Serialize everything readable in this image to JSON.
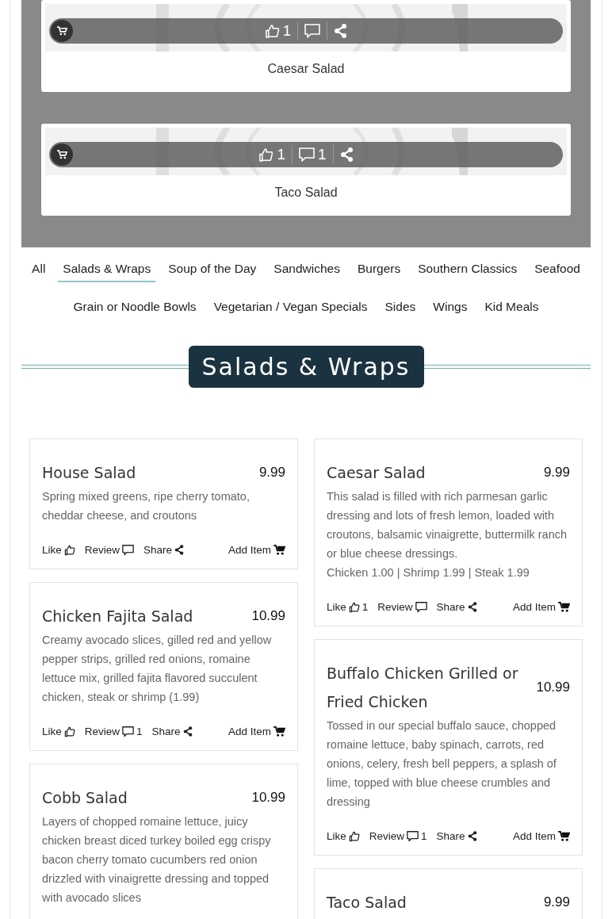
{
  "featured": [
    {
      "name": "Caesar Salad",
      "likes": "1"
    },
    {
      "name": "Taco Salad",
      "likes": "1",
      "reviews": "1"
    }
  ],
  "categories": [
    {
      "label": "All",
      "selected": false
    },
    {
      "label": "Salads & Wraps",
      "selected": true
    },
    {
      "label": "Soup of the Day",
      "selected": false
    },
    {
      "label": "Sandwiches",
      "selected": false
    },
    {
      "label": "Burgers",
      "selected": false
    },
    {
      "label": "Southern Classics",
      "selected": false
    },
    {
      "label": "Seafood",
      "selected": false
    },
    {
      "label": "Grain or Noodle Bowls",
      "selected": false
    },
    {
      "label": "Vegetarian / Vegan Specials",
      "selected": false
    },
    {
      "label": "Sides",
      "selected": false
    },
    {
      "label": "Wings",
      "selected": false
    },
    {
      "label": "Kid Meals",
      "selected": false
    }
  ],
  "section_title": "Salads & Wraps",
  "columns": [
    [
      {
        "name": "House Salad",
        "price": "9.99",
        "description": "Spring mixed greens, ripe cherry tomato, cheddar cheese, and croutons",
        "like": "Like",
        "review": "Review",
        "share": "Share",
        "add": "Add Item"
      },
      {
        "name": "Chicken Fajita Salad",
        "price": "10.99",
        "description": "Creamy avocado slices, gilled red and yellow pepper strips, grilled red onions, romaine lettuce mix, grilled fajita flavored succulent chicken, steak or shrimp (1.99)",
        "like": "Like",
        "review": "Review",
        "review_count": "1",
        "share": "Share",
        "add": "Add Item"
      },
      {
        "name": "Cobb Salad",
        "price": "10.99",
        "description": "Layers of chopped romaine lettuce, juicy chicken breast diced turkey boiled egg crispy bacon cherry tomato cucumbers red onion drizzled with vinaigrette dressing and topped with avocado slices"
      }
    ],
    [
      {
        "name": "Caesar Salad",
        "price": "9.99",
        "description": "This salad is filled with rich parmesan garlic dressing and lots of fresh lemon, loaded with croutons, balsamic vinaigrette, buttermilk ranch or blue cheese dressings.",
        "extras": "Chicken 1.00 | Shrimp 1.99 | Steak 1.99",
        "like": "Like",
        "like_count": "1",
        "review": "Review",
        "share": "Share",
        "add": "Add Item"
      },
      {
        "name": "Buffalo Chicken Grilled or Fried Chicken",
        "price": "10.99",
        "description": "Tossed in our special buffalo sauce, chopped romaine lettuce, baby spinach, carrots, red onions, celery, fresh bell peppers, a splash of lime, topped with blue cheese crumbles and dressing",
        "like": "Like",
        "review": "Review",
        "review_count": "1",
        "share": "Share",
        "add": "Add Item"
      },
      {
        "name": "Taco Salad",
        "price": "9.99"
      }
    ]
  ]
}
